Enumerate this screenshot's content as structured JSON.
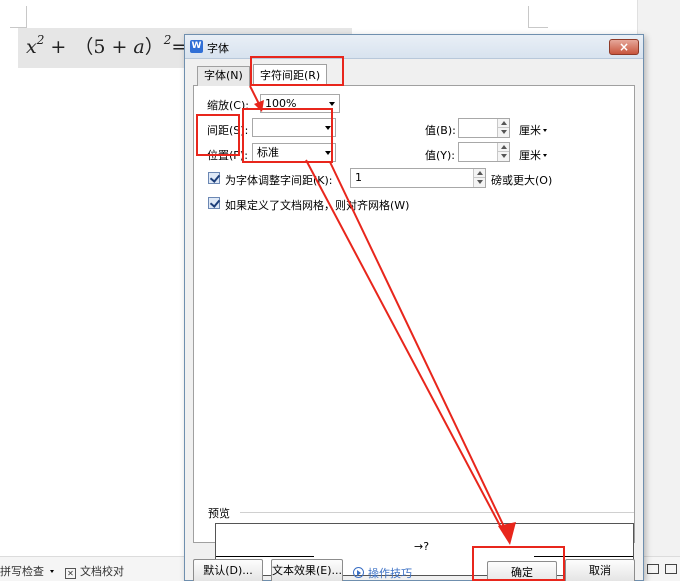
{
  "document": {
    "formula": {
      "x": "x",
      "exp1": "2",
      "plus1": " +",
      "paren_open": "（5 + ",
      "a": "a",
      "paren_close": "）",
      "exp2": "2",
      "equals": "="
    }
  },
  "statusbar": {
    "spell_check": "拼写检查",
    "doc_proofread": "文档校对"
  },
  "dialog": {
    "title": "字体",
    "title_icon": "W",
    "close_label": "×",
    "tabs": [
      {
        "label": "字体(N)"
      },
      {
        "label": "字符间距(R)"
      }
    ],
    "scale": {
      "label": "缩放(C):",
      "value": "100%"
    },
    "spacing": {
      "label": "间距(S):",
      "value": "",
      "value_label": "值(B):",
      "unit": "厘米"
    },
    "position": {
      "label": "位置(P):",
      "value": "标准",
      "value_label": "值(Y):",
      "unit": "厘米"
    },
    "kerning": {
      "label": "为字体调整字间距(K):",
      "value": "1",
      "suffix": "磅或更大(O)",
      "checked": true
    },
    "snap_grid": {
      "label": "如果定义了文档网格，则对齐网格(W)",
      "checked": true
    },
    "preview": {
      "label": "预览",
      "sample": "→?"
    },
    "buttons": {
      "default": "默认(D)...",
      "text_effects": "文本效果(E)...",
      "tips": "操作技巧",
      "ok": "确定",
      "cancel": "取消"
    }
  },
  "annotations": {
    "highlight_color": "#e8261c"
  }
}
